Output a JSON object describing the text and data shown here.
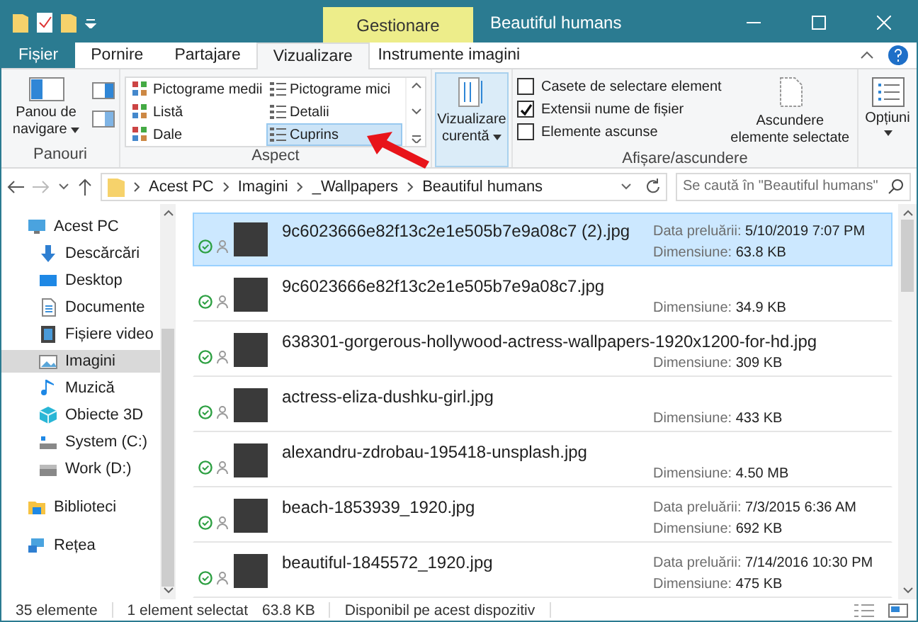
{
  "title_bar": {
    "contextual_header": "Gestionare",
    "title": "Beautiful humans"
  },
  "ribbon_tabs": [
    {
      "label": "Fișier",
      "kind": "file",
      "selected": false
    },
    {
      "label": "Pornire",
      "kind": "normal",
      "selected": false
    },
    {
      "label": "Partajare",
      "kind": "normal",
      "selected": false
    },
    {
      "label": "Vizualizare",
      "kind": "normal",
      "selected": true
    },
    {
      "label": "Instrumente imagini",
      "kind": "contextual",
      "selected": false
    }
  ],
  "ribbon": {
    "panes": {
      "button": "Panou de navigare",
      "group_label": "Panouri"
    },
    "layout": {
      "items": [
        {
          "label": "Pictograme medii",
          "selected": false
        },
        {
          "label": "Pictograme mici",
          "selected": false
        },
        {
          "label": "Listă",
          "selected": false
        },
        {
          "label": "Detalii",
          "selected": false
        },
        {
          "label": "Dale",
          "selected": false
        },
        {
          "label": "Cuprins",
          "selected": true
        }
      ],
      "group_label": "Aspect"
    },
    "current_view": {
      "label": "Vizualizare curentă"
    },
    "show_hide": {
      "checkboxes": [
        {
          "label": "Casete de selectare element",
          "checked": false
        },
        {
          "label": "Extensii nume de fișier",
          "checked": true
        },
        {
          "label": "Elemente ascunse",
          "checked": false
        }
      ],
      "hide_button": "Ascundere elemente selectate",
      "group_label": "Afișare/ascundere"
    },
    "options": {
      "label": "Opțiuni"
    }
  },
  "address_bar": {
    "crumbs": [
      "Acest PC",
      "Imagini",
      "_Wallpapers",
      "Beautiful humans"
    ],
    "search_placeholder": "Se caută în \"Beautiful humans\""
  },
  "sidebar": {
    "items": [
      {
        "label": "Acest PC",
        "kind": "pc",
        "selected": false,
        "children": [
          {
            "label": "Descărcări",
            "kind": "download",
            "selected": false
          },
          {
            "label": "Desktop",
            "kind": "desktop",
            "selected": false
          },
          {
            "label": "Documente",
            "kind": "document",
            "selected": false
          },
          {
            "label": "Fișiere video",
            "kind": "video",
            "selected": false
          },
          {
            "label": "Imagini",
            "kind": "pictures",
            "selected": true
          },
          {
            "label": "Muzică",
            "kind": "music",
            "selected": false
          },
          {
            "label": "Obiecte 3D",
            "kind": "objects",
            "selected": false
          },
          {
            "label": "System (C:)",
            "kind": "system-drive",
            "selected": false
          },
          {
            "label": "Work (D:)",
            "kind": "drive",
            "selected": false
          }
        ]
      },
      {
        "label": "Biblioteci",
        "kind": "library",
        "selected": false
      },
      {
        "label": "Rețea",
        "kind": "network",
        "selected": false
      }
    ]
  },
  "files": [
    {
      "name": "9c6023666e82f13c2e1e505b7e9a08c7 (2).jpg",
      "selected": true,
      "details": [
        {
          "label": "Data preluării:",
          "value": "5/10/2019 7:07 PM"
        },
        {
          "label": "Dimensiune:",
          "value": "63.8 KB"
        }
      ]
    },
    {
      "name": "9c6023666e82f13c2e1e505b7e9a08c7.jpg",
      "selected": false,
      "details": [
        {
          "label": "Dimensiune:",
          "value": "34.9 KB"
        }
      ]
    },
    {
      "name": "638301-gorgerous-hollywood-actress-wallpapers-1920x1200-for-hd.jpg",
      "selected": false,
      "details": [
        {
          "label": "Dimensiune:",
          "value": "309 KB"
        }
      ]
    },
    {
      "name": "actress-eliza-dushku-girl.jpg",
      "selected": false,
      "details": [
        {
          "label": "Dimensiune:",
          "value": "433 KB"
        }
      ]
    },
    {
      "name": "alexandru-zdrobau-195418-unsplash.jpg",
      "selected": false,
      "details": [
        {
          "label": "Dimensiune:",
          "value": "4.50 MB"
        }
      ]
    },
    {
      "name": "beach-1853939_1920.jpg",
      "selected": false,
      "details": [
        {
          "label": "Data preluării:",
          "value": "7/3/2015 6:36 AM"
        },
        {
          "label": "Dimensiune:",
          "value": "692 KB"
        }
      ]
    },
    {
      "name": "beautiful-1845572_1920.jpg",
      "selected": false,
      "details": [
        {
          "label": "Data preluării:",
          "value": "7/14/2016 10:30 PM"
        },
        {
          "label": "Dimensiune:",
          "value": "475 KB"
        }
      ]
    }
  ],
  "status_bar": {
    "count": "35 elemente",
    "selection": "1 element selectat",
    "selection_size": "63.8 KB",
    "availability": "Disponibil pe acest dispozitiv"
  }
}
